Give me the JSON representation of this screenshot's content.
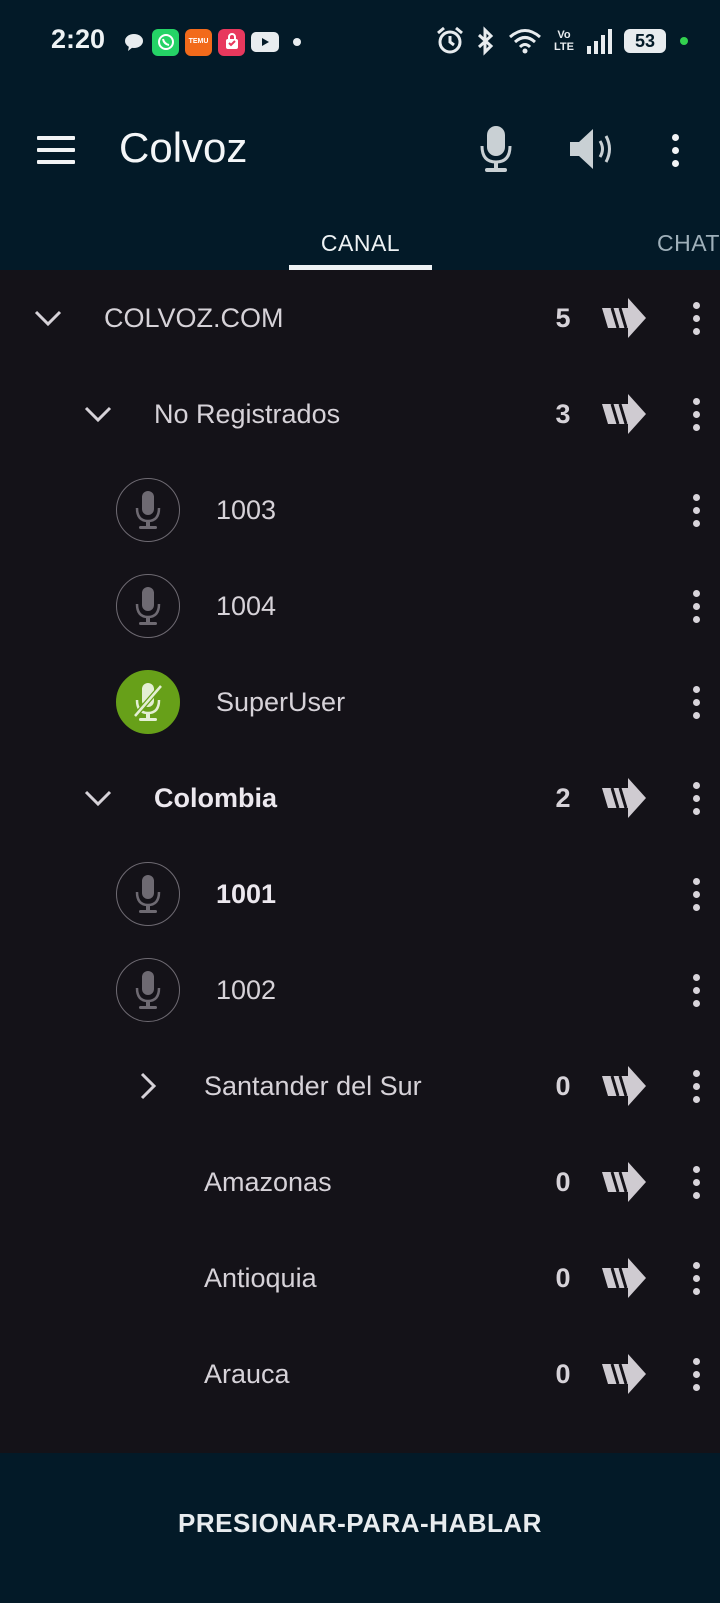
{
  "status_bar": {
    "time": "2:20",
    "notifications": [
      "chat-bubble-icon",
      "whatsapp-icon",
      "temu-icon",
      "shopping-bag-icon",
      "youtube-icon",
      "more-notifications-dot"
    ],
    "temu_text": "TEMU",
    "system": [
      "alarm-icon",
      "bluetooth-icon",
      "wifi-icon",
      "volte-icon",
      "signal-icon"
    ],
    "volte_text": "Vo LTE",
    "battery": "53"
  },
  "app_bar": {
    "title": "Colvoz",
    "actions": [
      "microphone-icon",
      "speaker-icon",
      "more-vert-icon"
    ]
  },
  "tabs": [
    {
      "label": "CANAL",
      "selected": true
    },
    {
      "label": "CHAT",
      "selected": false
    }
  ],
  "tree": [
    {
      "type": "channel",
      "label": "COLVOZ.COM",
      "count": "5",
      "expanded": true,
      "bold": false
    },
    {
      "type": "channel",
      "label": "No Registrados",
      "count": "3",
      "expanded": true,
      "bold": false
    },
    {
      "type": "user",
      "label": "1003",
      "active": false,
      "bold": false
    },
    {
      "type": "user",
      "label": "1004",
      "active": false,
      "bold": false
    },
    {
      "type": "user",
      "label": "SuperUser",
      "active": true,
      "bold": false
    },
    {
      "type": "channel",
      "label": "Colombia",
      "count": "2",
      "expanded": true,
      "bold": true
    },
    {
      "type": "user",
      "label": "1001",
      "active": false,
      "bold": true
    },
    {
      "type": "user",
      "label": "1002",
      "active": false,
      "bold": false
    },
    {
      "type": "channel",
      "label": "Santander del Sur",
      "count": "0",
      "expanded": false,
      "bold": false
    },
    {
      "type": "channel",
      "label": "Amazonas",
      "count": "0",
      "bold": false
    },
    {
      "type": "channel",
      "label": "Antioquia",
      "count": "0",
      "bold": false
    },
    {
      "type": "channel",
      "label": "Arauca",
      "count": "0",
      "bold": false
    }
  ],
  "ptt": {
    "label": "PRESIONAR-PARA-HABLAR"
  },
  "colors": {
    "bar_background": "#031a28",
    "list_background": "#141218",
    "active_user": "#67a019"
  }
}
